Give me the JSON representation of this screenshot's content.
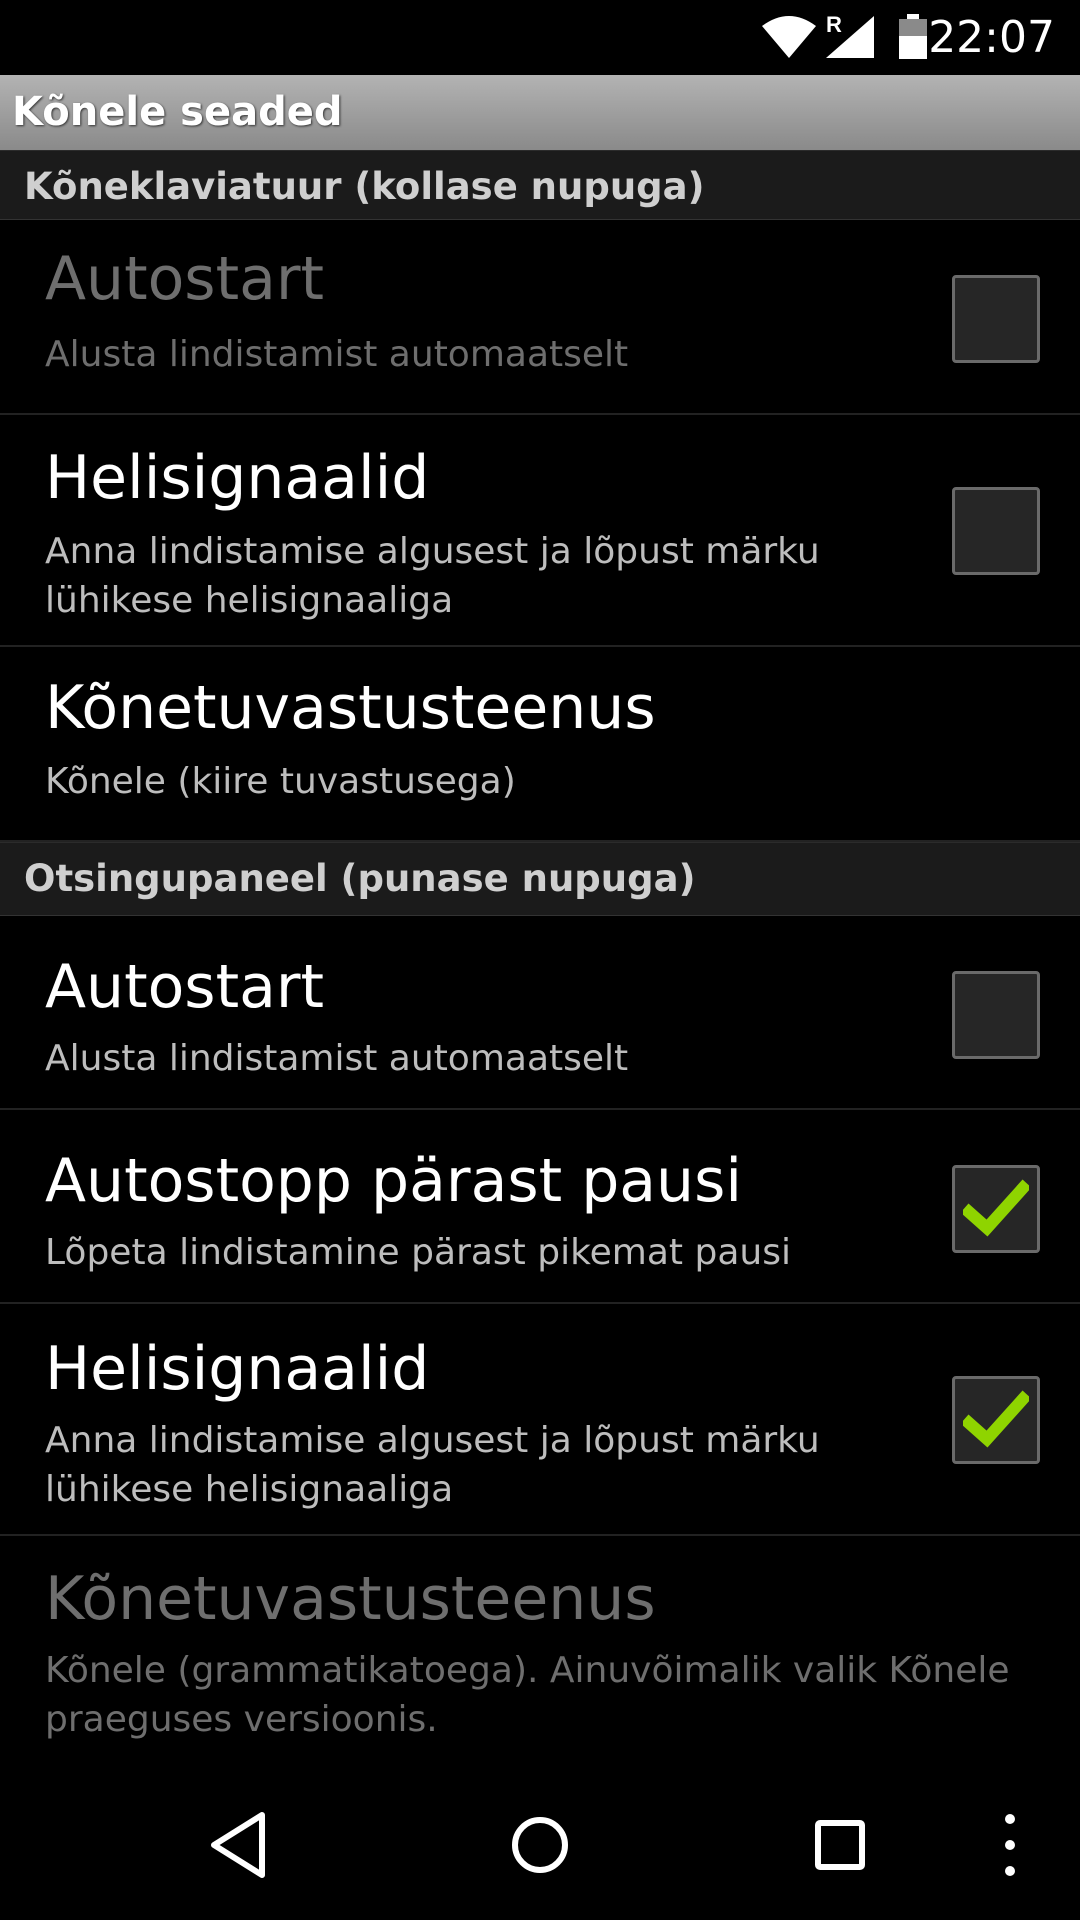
{
  "status_bar": {
    "time": "22:07",
    "roaming_indicator": "R",
    "icons": [
      "wifi-icon",
      "signal-icon",
      "battery-icon"
    ]
  },
  "action_bar": {
    "title": "Kõnele seaded"
  },
  "sections": [
    {
      "header": "Kõneklaviatuur (kollase nupuga)",
      "items": [
        {
          "title": "Autostart",
          "summary": "Alusta lindistamist automaatselt",
          "checkbox": true,
          "checked": false,
          "enabled": false
        },
        {
          "title": "Helisignaalid",
          "summary": "Anna lindistamise algusest ja lõpust märku lühikese helisignaaliga",
          "checkbox": true,
          "checked": false,
          "enabled": true
        },
        {
          "title": "Kõnetuvastusteenus",
          "summary": "Kõnele (kiire tuvastusega)",
          "checkbox": false,
          "enabled": true
        }
      ]
    },
    {
      "header": "Otsingupaneel (punase nupuga)",
      "items": [
        {
          "title": "Autostart",
          "summary": "Alusta lindistamist automaatselt",
          "checkbox": true,
          "checked": false,
          "enabled": true
        },
        {
          "title": "Autostopp pärast pausi",
          "summary": "Lõpeta lindistamine pärast pikemat pausi",
          "checkbox": true,
          "checked": true,
          "enabled": true
        },
        {
          "title": "Helisignaalid",
          "summary": "Anna lindistamise algusest ja lõpust märku lühikese helisignaaliga",
          "checkbox": true,
          "checked": true,
          "enabled": true
        },
        {
          "title": "Kõnetuvastusteenus",
          "summary": "Kõnele (grammatikatoega). Ainuvõimalik valik Kõnele praeguses versioonis.",
          "checkbox": false,
          "enabled": false
        }
      ]
    }
  ],
  "nav_bar": {
    "buttons": [
      "back-icon",
      "home-icon",
      "recents-icon",
      "overflow-menu-icon"
    ]
  },
  "colors": {
    "check_green": "#8fd400",
    "background": "#000000",
    "category_bg": "#1b1b1b"
  }
}
